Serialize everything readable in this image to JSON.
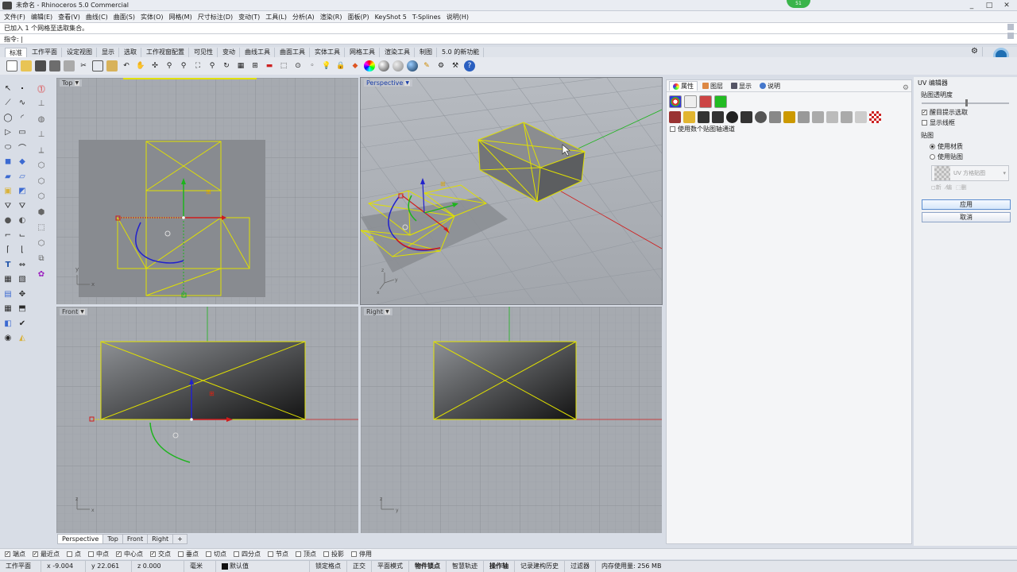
{
  "window": {
    "title": "未命名 - Rhinoceros 5.0 Commercial",
    "notification_count": "51",
    "buttons": [
      "_",
      "□",
      "✕"
    ]
  },
  "menu": [
    "文件(F)",
    "编辑(E)",
    "查看(V)",
    "曲线(C)",
    "曲面(S)",
    "实体(O)",
    "网格(M)",
    "尺寸标注(D)",
    "变动(T)",
    "工具(L)",
    "分析(A)",
    "渲染(R)",
    "面板(P)",
    "KeyShot 5",
    "T-Splines",
    "说明(H)"
  ],
  "command": {
    "history": "已加入 1 个网格至选取集合。",
    "prompt": "指令: "
  },
  "toolbar_tabs": [
    "标准",
    "工作平面",
    "设定视图",
    "显示",
    "选取",
    "工作视窗配置",
    "可见性",
    "变动",
    "曲线工具",
    "曲面工具",
    "实体工具",
    "网格工具",
    "渲染工具",
    "制图",
    "5.0 的新功能"
  ],
  "viewports": {
    "top": "Top",
    "perspective": "Perspective",
    "front": "Front",
    "right": "Right"
  },
  "viewport_tabs": [
    "Perspective",
    "Top",
    "Front",
    "Right",
    "+"
  ],
  "properties": {
    "tabs": [
      "属性",
      "图层",
      "显示",
      "说明"
    ],
    "option": "使用数个贴图轴通道"
  },
  "uv_editor": {
    "title": "UV 编辑器",
    "transparency": "贴图透明度",
    "highlight": "醒目提示选取",
    "show_wire": "显示线框",
    "mapping": "贴图",
    "use_material": "使用材质",
    "use_mapping": "使用贴图",
    "preview_label": "UV 方格贴图",
    "small_buttons": [
      "◻新",
      "⁄编",
      "⬚删"
    ],
    "apply": "应用",
    "cancel": "取消"
  },
  "osnaps": [
    {
      "label": "端点",
      "checked": true
    },
    {
      "label": "最近点",
      "checked": true
    },
    {
      "label": "点",
      "checked": false
    },
    {
      "label": "中点",
      "checked": false
    },
    {
      "label": "中心点",
      "checked": true
    },
    {
      "label": "交点",
      "checked": true
    },
    {
      "label": "垂点",
      "checked": false
    },
    {
      "label": "切点",
      "checked": false
    },
    {
      "label": "四分点",
      "checked": false
    },
    {
      "label": "节点",
      "checked": false
    },
    {
      "label": "顶点",
      "checked": false
    },
    {
      "label": "投影",
      "checked": false
    },
    {
      "label": "停用",
      "checked": false
    }
  ],
  "status": {
    "cplane": "工作平面",
    "x": "x -9.004",
    "y": "y 22.061",
    "z": "z 0.000",
    "units": "毫米",
    "layer": "默认值",
    "grid_snap": "锁定格点",
    "ortho": "正交",
    "planar": "平面模式",
    "osnap": "物件锁点",
    "smarttrack": "智慧轨迹",
    "gumball": "操作轴",
    "history": "记录建构历史",
    "filter": "过滤器",
    "memory": "内存使用量: 256 MB"
  },
  "colors": {
    "viewport_bg": "#a6aab0",
    "selection": "#e0e000",
    "x_axis": "#d01c1c",
    "y_axis": "#1db41d",
    "z_axis": "#2222cc"
  }
}
